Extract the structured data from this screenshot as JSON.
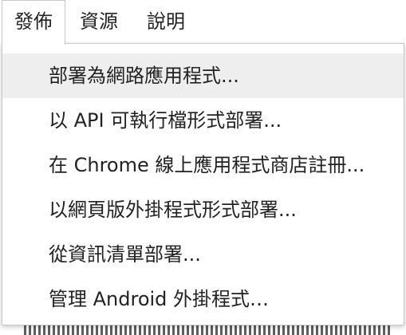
{
  "menubar": {
    "items": [
      {
        "label": "發佈",
        "active": true
      },
      {
        "label": "資源",
        "active": false
      },
      {
        "label": "說明",
        "active": false
      }
    ]
  },
  "publish_menu": {
    "items": [
      {
        "label": "部署為網路應用程式...",
        "highlighted": true
      },
      {
        "label": "以 API 可執行檔形式部署...",
        "highlighted": false
      },
      {
        "label": "在 Chrome 線上應用程式商店註冊...",
        "highlighted": false
      },
      {
        "label": "以網頁版外掛程式形式部署...",
        "highlighted": false
      },
      {
        "label": "從資訊清單部署...",
        "highlighted": false
      },
      {
        "label": "管理 Android 外掛程式…",
        "highlighted": false
      }
    ]
  },
  "colors": {
    "highlight": "#eeeeee",
    "border": "#c8c8c8",
    "text": "#222222"
  }
}
